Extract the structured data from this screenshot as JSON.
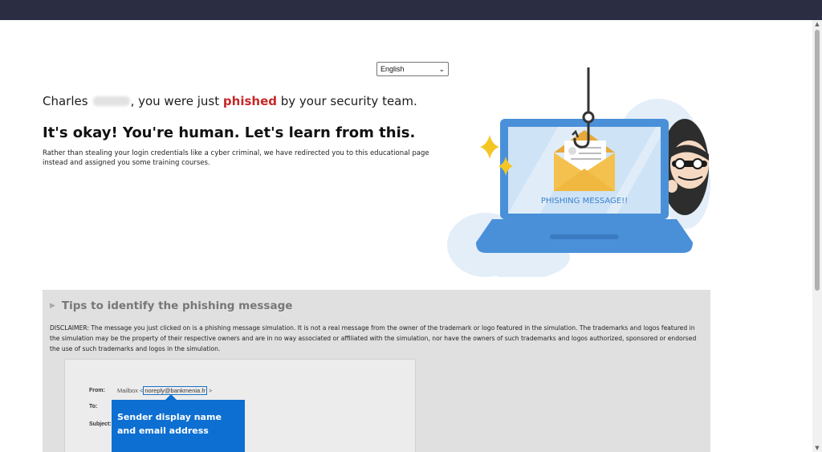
{
  "language_select": {
    "value": "English"
  },
  "greeting": {
    "first_name": "Charles",
    "before_phished": ", you were just ",
    "phished": "phished",
    "after_phished": " by your security team."
  },
  "headline": "It's okay! You're human. Let's learn from this.",
  "intro": "Rather than stealing your login credentials like a cyber criminal, we have redirected you to this educational page instead and assigned you some training courses.",
  "illustration": {
    "screen_text": "PHISHING MESSAGE!!"
  },
  "tips": {
    "title": "Tips to identify the phishing message",
    "disclaimer": "DISCLAIMER: The message you just clicked on is a phishing message simulation. It is not a real message from the owner of the trademark or logo featured in the simulation. The trademarks and logos featured in the simulation may be the property of their respective owners and are in no way associated or affiliated with the simulation, nor have the owners of such trademarks and logos authorized, sponsored or endorsed the use of such trademarks and logos in the simulation."
  },
  "email_preview": {
    "from_label": "From:",
    "from_name": "Mailbox <",
    "from_email": "noreply@bankmenia.fr",
    "from_close": " >",
    "to_label": "To:",
    "subject_label": "Subject:"
  },
  "tooltip": {
    "text": "Sender display name and email address"
  },
  "colors": {
    "accent": "#0d6fd1",
    "phished": "#c62828",
    "topbar": "#2b2d42"
  }
}
